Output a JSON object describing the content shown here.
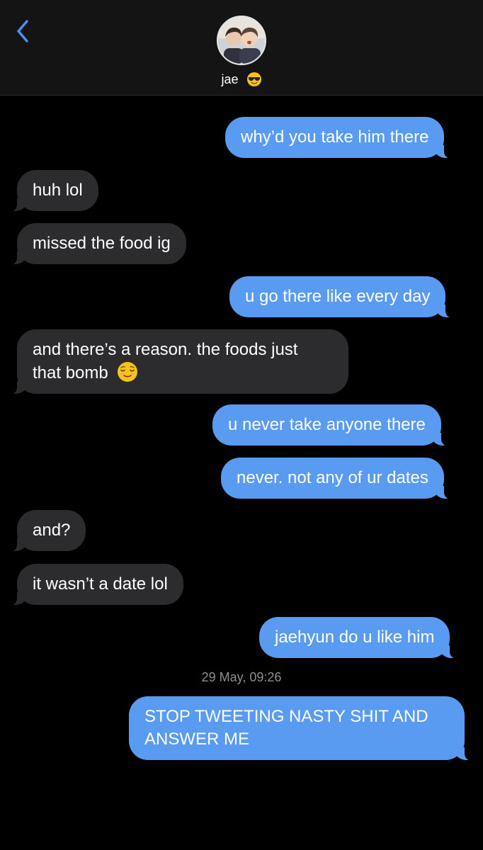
{
  "header": {
    "contact_name": "jae",
    "contact_emoji": "sunglasses-face-emoji",
    "back_icon": "chevron-left-icon",
    "accent_color": "#4a90f5"
  },
  "messages": [
    {
      "side": "sent",
      "text": "why’d you take him there"
    },
    {
      "side": "recv",
      "text": "huh lol"
    },
    {
      "side": "recv",
      "text": "missed the food ig"
    },
    {
      "side": "sent",
      "text": "u go there like every day"
    },
    {
      "side": "recv",
      "line1": "and there’s a reason. the foods just",
      "line2": "that bomb",
      "emoji": "relieved-face-emoji"
    },
    {
      "side": "sent",
      "text": "u never take anyone there"
    },
    {
      "side": "sent",
      "text": "never. not any of ur dates"
    },
    {
      "side": "recv",
      "text": "and?"
    },
    {
      "side": "recv",
      "text": "it wasn’t a date lol"
    },
    {
      "side": "sent",
      "text": "jaehyun do u like him"
    },
    {
      "side": "sent",
      "line1": "STOP TWEETING NASTY SHIT AND",
      "line2": "ANSWER ME"
    }
  ],
  "timestamp": "29 May, 09:26",
  "colors": {
    "sent_bubble": "#5a9bf2",
    "received_bubble": "#2c2c2e",
    "background": "#000000",
    "timestamp_text": "#8e8e93"
  }
}
